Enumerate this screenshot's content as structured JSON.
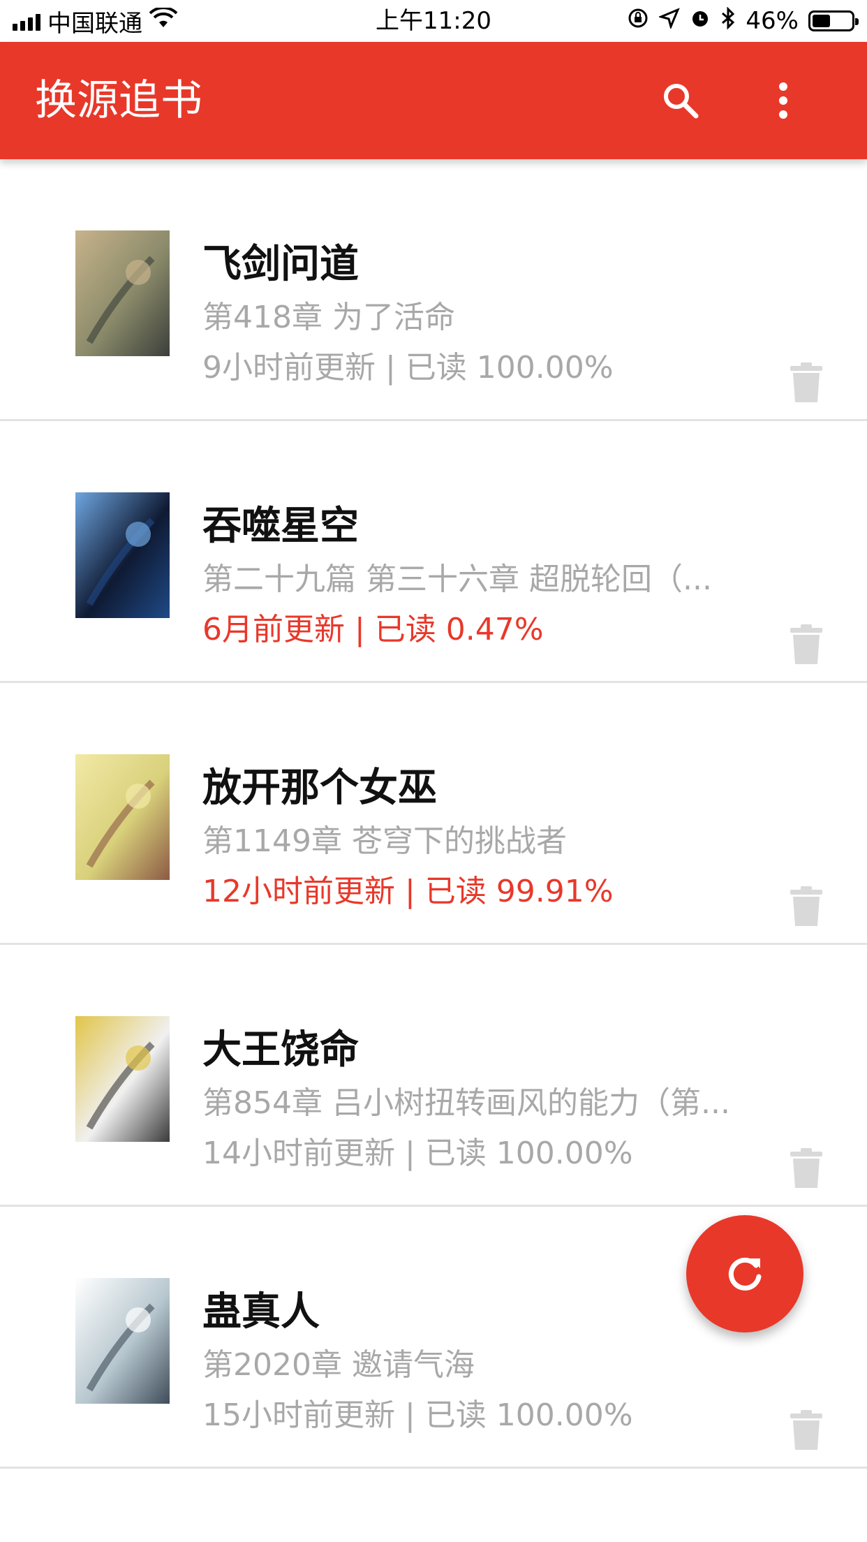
{
  "status_bar": {
    "carrier": "中国联通",
    "time": "上午11:20",
    "battery_percent": "46%",
    "battery_level": 0.46
  },
  "app_bar": {
    "title": "换源追书",
    "actions": [
      "search-icon",
      "more-vert-icon"
    ]
  },
  "books": [
    {
      "title": "飞剑问道",
      "chapter": "第418章 为了活命",
      "meta": "9小时前更新 | 已读 100.00%",
      "highlight": false,
      "cover_colors": [
        "#8a8a6a",
        "#3b3f3a",
        "#c7b38b"
      ]
    },
    {
      "title": "吞噬星空",
      "chapter": "第二十九篇 第三十六章 超脱轮回（...",
      "meta": "6月前更新 | 已读 0.47%",
      "highlight": true,
      "cover_colors": [
        "#0f1a33",
        "#1f4a87",
        "#6fa6e0"
      ]
    },
    {
      "title": "放开那个女巫",
      "chapter": "第1149章 苍穹下的挑战者",
      "meta": "12小时前更新 | 已读 99.91%",
      "highlight": true,
      "cover_colors": [
        "#d8d07a",
        "#8c5a45",
        "#f2e9a6"
      ]
    },
    {
      "title": "大王饶命",
      "chapter": "第854章 吕小树扭转画风的能力（第...",
      "meta": "14小时前更新 | 已读 100.00%",
      "highlight": false,
      "cover_colors": [
        "#f0f0f0",
        "#3a3a3a",
        "#e1c54a"
      ]
    },
    {
      "title": "蛊真人",
      "chapter": "第2020章 邀请气海",
      "meta": "15小时前更新 | 已读 100.00%",
      "highlight": false,
      "cover_colors": [
        "#b7c7cf",
        "#3f4d5a",
        "#ffffff"
      ]
    }
  ],
  "fab": {
    "icon": "refresh-icon"
  },
  "colors": {
    "accent": "#E8382A",
    "muted": "#a8a8a8",
    "divider": "#e3e3e3"
  }
}
